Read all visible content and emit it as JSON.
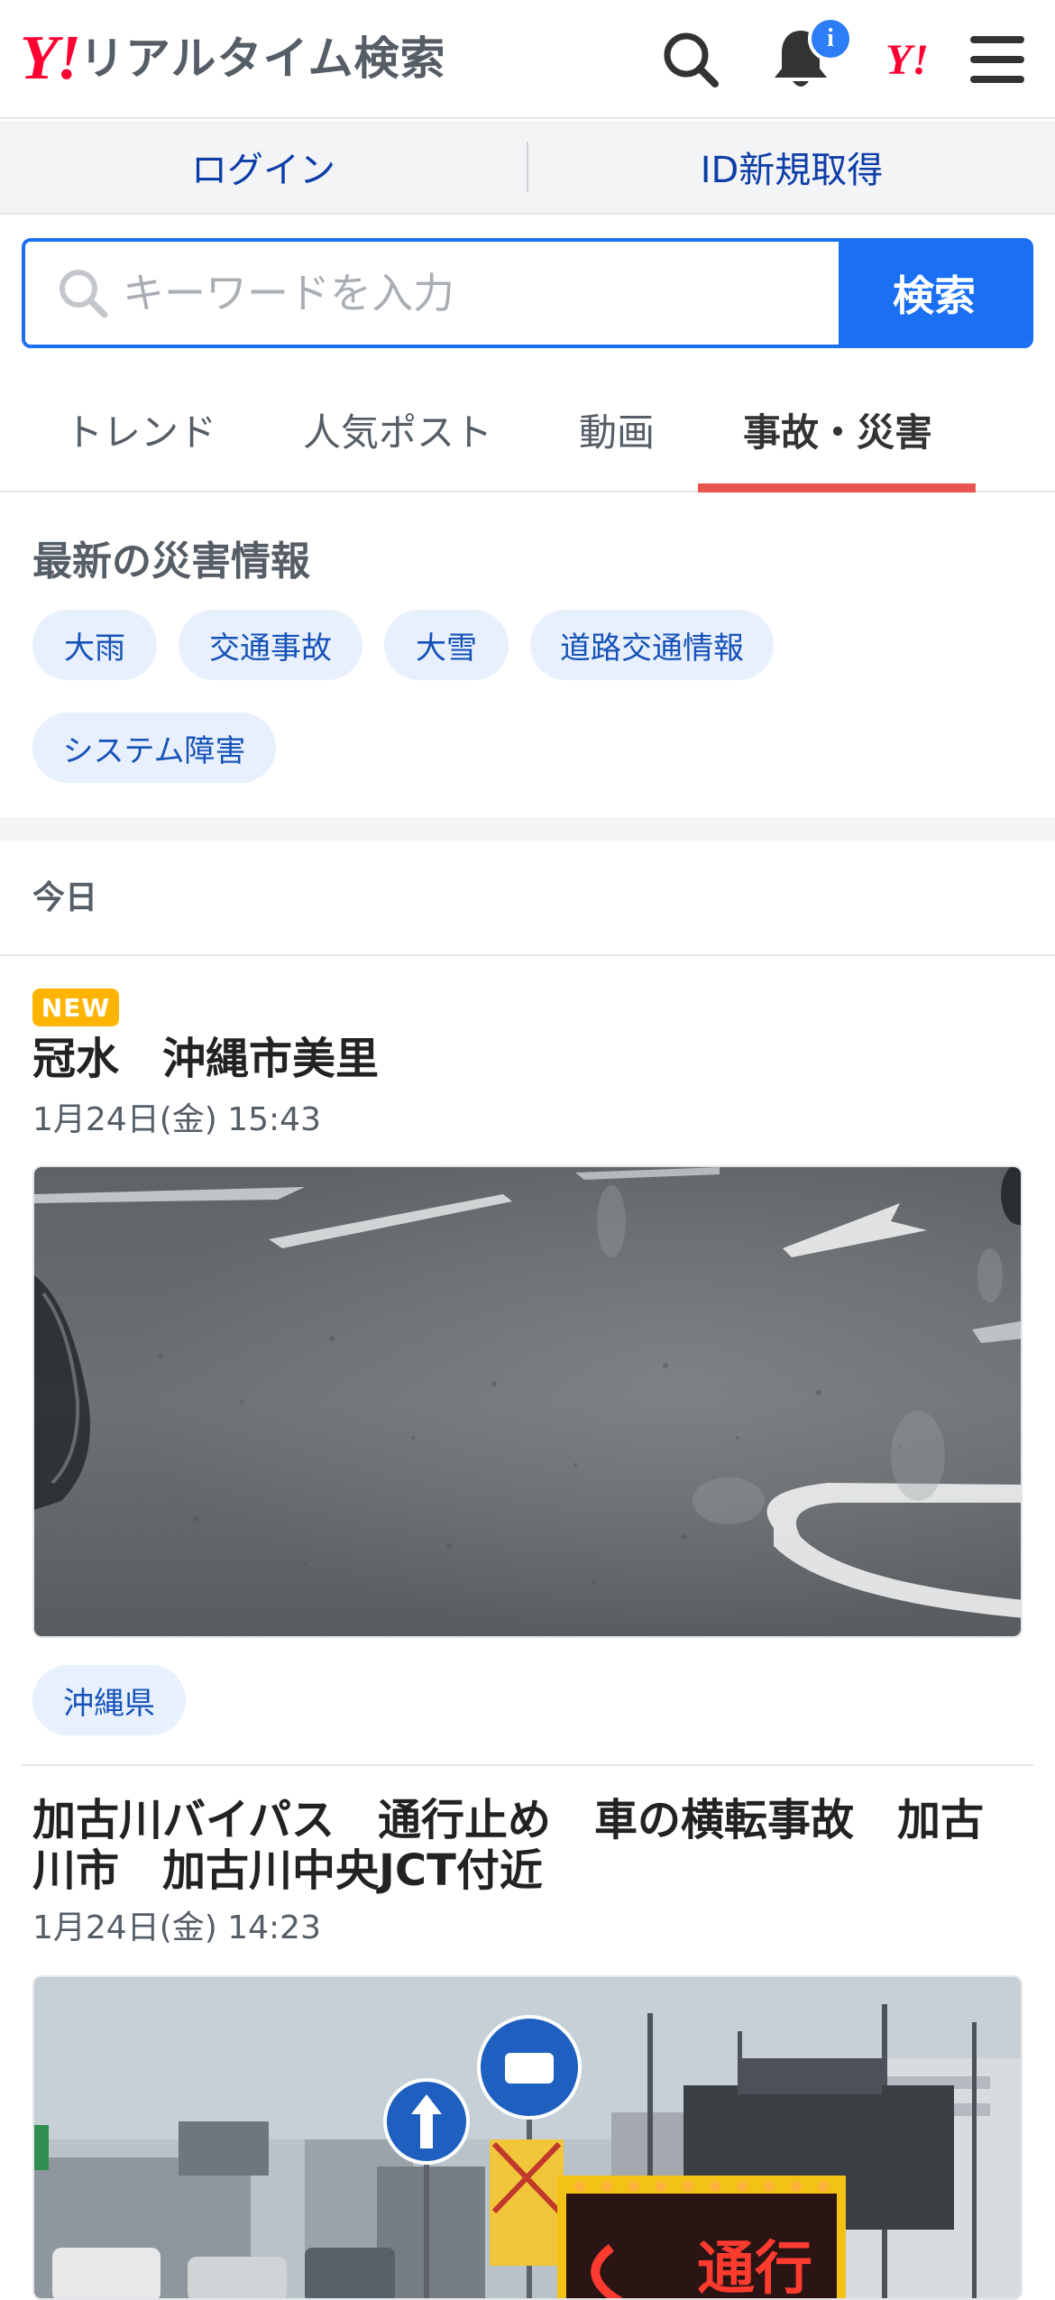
{
  "header": {
    "logo_mark": "Y!",
    "title": "リアルタイム検索",
    "notification_badge": "i",
    "yahoo_mark": "Y!"
  },
  "loginbar": {
    "login": "ログイン",
    "register": "ID新規取得"
  },
  "search": {
    "placeholder": "キーワードを入力",
    "button": "検索"
  },
  "tabs": [
    {
      "label": "トレンド",
      "active": false
    },
    {
      "label": "人気ポスト",
      "active": false
    },
    {
      "label": "動画",
      "active": false
    },
    {
      "label": "事故・災害",
      "active": true
    }
  ],
  "disaster": {
    "title": "最新の災害情報",
    "chips": [
      "大雨",
      "交通事故",
      "大雪",
      "道路交通情報",
      "システム障害"
    ]
  },
  "day_label": "今日",
  "articles": [
    {
      "badge": "NEW",
      "title": "冠水　沖縄市美里",
      "time": "1月24日(金) 15:43",
      "tag": "沖縄県"
    },
    {
      "title": "加古川バイパス　通行止め　車の横転事故　加古川市　加古川中央JCT付近",
      "time": "1月24日(金) 14:23",
      "sign_text": "通行"
    }
  ],
  "colors": {
    "brand_red": "#ff0033",
    "accent_blue": "#1a6ff2",
    "tab_underline": "#e8554e",
    "new_badge": "#ffb400",
    "chip_bg": "#e7f0fc"
  }
}
